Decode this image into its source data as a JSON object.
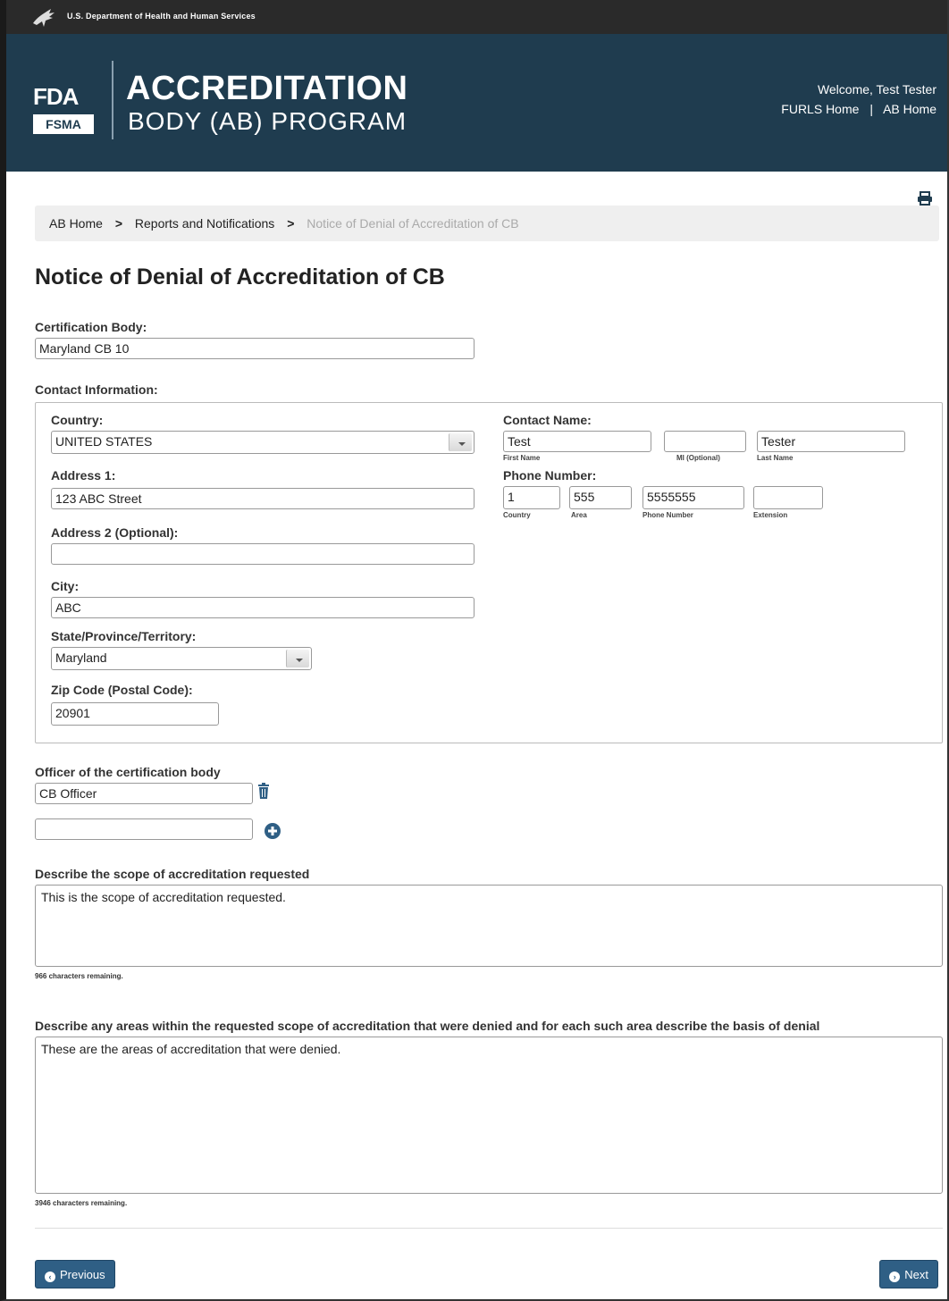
{
  "header": {
    "hhs_text": "U.S. Department of Health and Human Services",
    "logo_fda": "FDA",
    "logo_fsma": "FSMA",
    "title_line1": "ACCREDITATION",
    "title_line2": "BODY (AB) PROGRAM",
    "welcome": "Welcome, Test Tester",
    "links": {
      "furls_home": "FURLS Home",
      "separator": "|",
      "ab_home": "AB Home"
    }
  },
  "breadcrumb": {
    "items": [
      "AB Home",
      "Reports and Notifications",
      "Notice of Denial of Accreditation of CB"
    ],
    "separator": ">"
  },
  "page_title": "Notice of Denial of Accreditation of CB",
  "form": {
    "certification_body": {
      "label": "Certification Body:",
      "value": "Maryland CB 10"
    },
    "contact_info": {
      "label": "Contact Information:",
      "country": {
        "label": "Country:",
        "value": "UNITED STATES"
      },
      "address1": {
        "label": "Address 1:",
        "value": "123 ABC Street"
      },
      "address2": {
        "label": "Address 2 (Optional):",
        "value": ""
      },
      "city": {
        "label": "City:",
        "value": "ABC"
      },
      "state": {
        "label": "State/Province/Territory:",
        "value": "Maryland"
      },
      "zip": {
        "label": "Zip Code (Postal Code):",
        "value": "20901"
      },
      "contact_name": {
        "label": "Contact Name:",
        "first": {
          "value": "Test",
          "caption": "First Name"
        },
        "mi": {
          "value": "",
          "caption": "MI (Optional)"
        },
        "last": {
          "value": "Tester",
          "caption": "Last Name"
        }
      },
      "phone": {
        "label": "Phone Number:",
        "country": {
          "value": "1",
          "caption": "Country"
        },
        "area": {
          "value": "555",
          "caption": "Area"
        },
        "number": {
          "value": "5555555",
          "caption": "Phone Number"
        },
        "extension": {
          "value": "",
          "caption": "Extension"
        }
      }
    },
    "officer": {
      "label": "Officer of the certification body",
      "values": [
        "CB Officer",
        ""
      ]
    },
    "scope": {
      "label": "Describe the scope of accreditation requested",
      "value": "This is the scope of accreditation requested.",
      "remaining": "966 characters remaining."
    },
    "denied_areas": {
      "label": "Describe any areas within the requested scope of accreditation that were denied and for each such area describe the basis of denial",
      "value": "These are the areas of accreditation that were denied.",
      "remaining": "3946 characters remaining."
    }
  },
  "buttons": {
    "previous": "Previous",
    "next": "Next"
  },
  "icons": {
    "hhs": "hhs-eagle-icon",
    "print": "print-icon",
    "trash": "trash-icon",
    "add": "plus-circle-icon",
    "select_arrow": "chevron-down-icon",
    "previous": "chevron-left-icon",
    "next": "chevron-right-icon"
  },
  "colors": {
    "banner": "#1f3c4f",
    "topbar": "#2a2a2a",
    "button": "#2f5f85",
    "breadcrumb_bg": "#efefef"
  }
}
